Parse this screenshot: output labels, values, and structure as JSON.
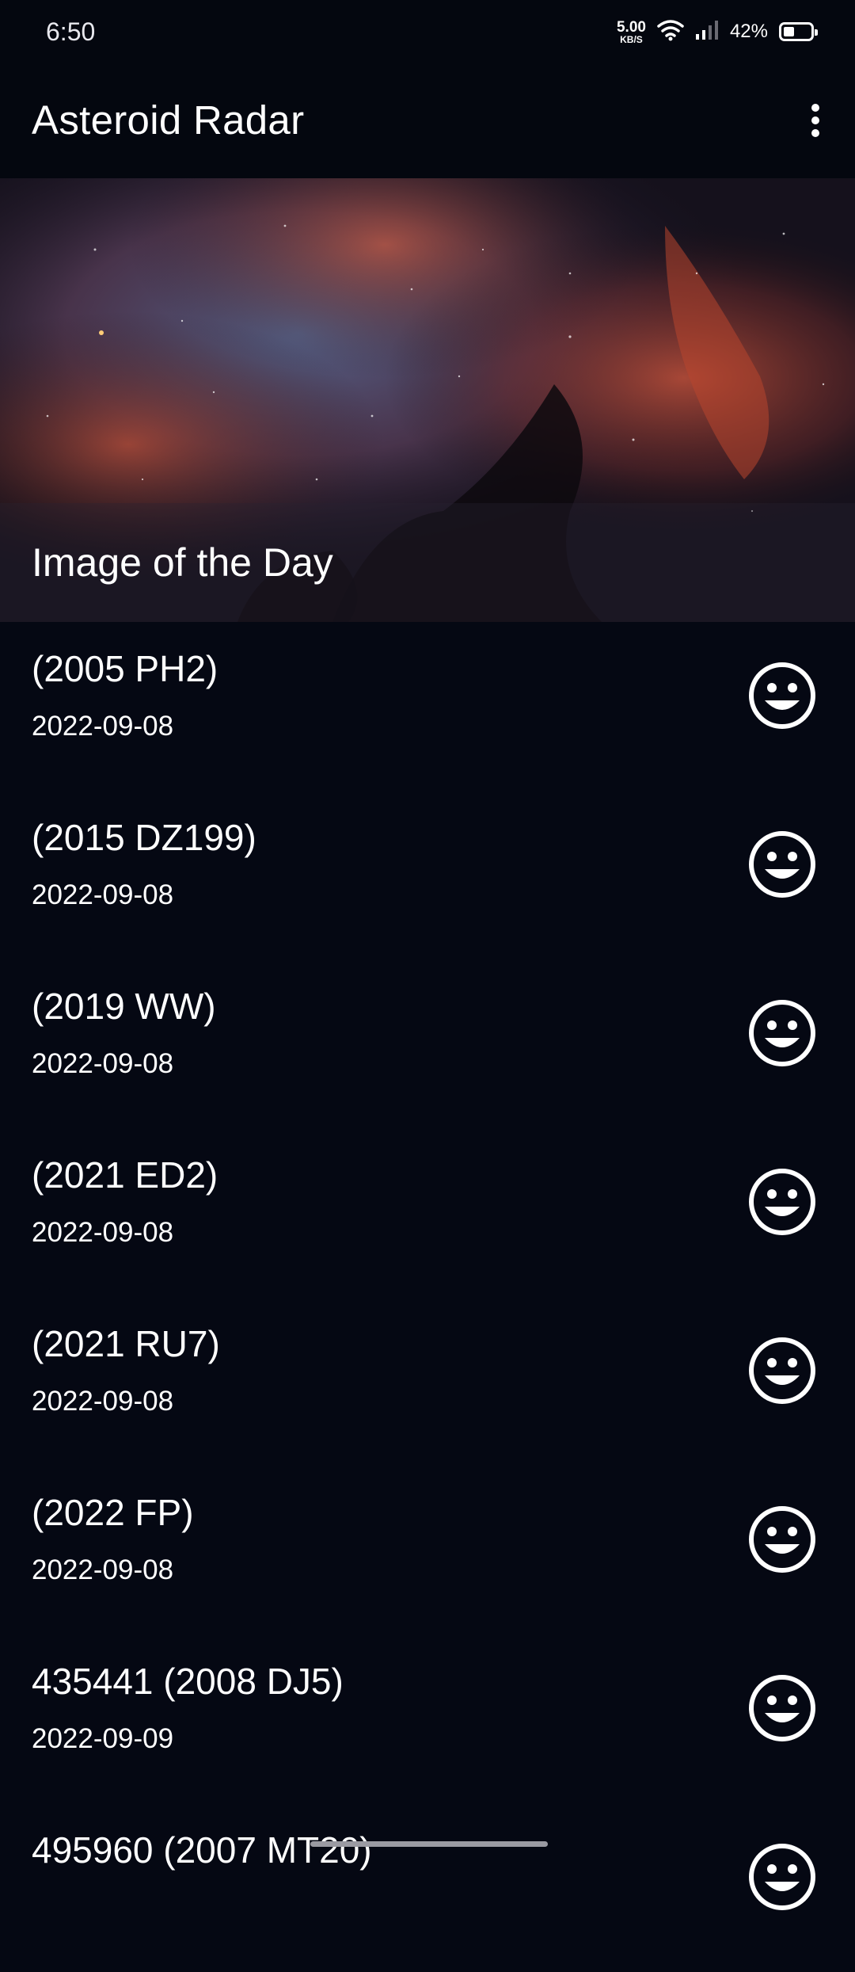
{
  "status_bar": {
    "time": "6:50",
    "net_speed_value": "5.00",
    "net_speed_unit": "KB/S",
    "battery_percent": "42%",
    "battery_level": 0.42
  },
  "app_bar": {
    "title": "Asteroid Radar",
    "overflow_icon": "more-vert-icon"
  },
  "image_of_day": {
    "caption": "Image of the Day"
  },
  "asteroids": [
    {
      "name": "(2005 PH2)",
      "date": "2022-09-08",
      "icon": "happy-face-icon"
    },
    {
      "name": "(2015 DZ199)",
      "date": "2022-09-08",
      "icon": "happy-face-icon"
    },
    {
      "name": "(2019 WW)",
      "date": "2022-09-08",
      "icon": "happy-face-icon"
    },
    {
      "name": "(2021 ED2)",
      "date": "2022-09-08",
      "icon": "happy-face-icon"
    },
    {
      "name": "(2021 RU7)",
      "date": "2022-09-08",
      "icon": "happy-face-icon"
    },
    {
      "name": "(2022 FP)",
      "date": "2022-09-08",
      "icon": "happy-face-icon"
    },
    {
      "name": "435441 (2008 DJ5)",
      "date": "2022-09-09",
      "icon": "happy-face-icon"
    },
    {
      "name": "495960 (2007 MT20)",
      "date": "",
      "icon": "happy-face-icon"
    }
  ],
  "colors": {
    "background": "#050813",
    "text": "#ffffff"
  }
}
